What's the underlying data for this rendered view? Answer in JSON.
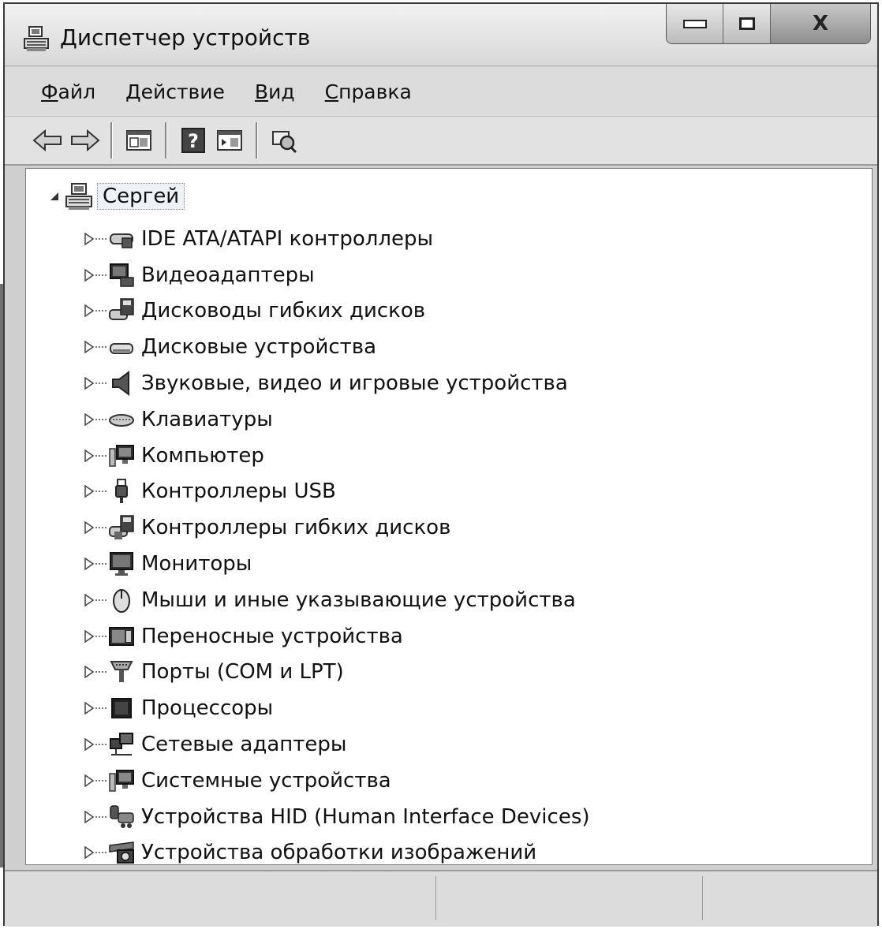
{
  "window": {
    "title": "Диспетчер устройств",
    "icon": "device-manager-icon",
    "caption_buttons": [
      "minimize",
      "maximize",
      "close"
    ],
    "close_glyph": "X"
  },
  "menu": {
    "items": [
      {
        "mnemonic": "Ф",
        "rest": "айл"
      },
      {
        "mnemonic": "Д",
        "rest": "ействие"
      },
      {
        "mnemonic": "В",
        "rest": "ид"
      },
      {
        "mnemonic": "С",
        "rest": "правка"
      }
    ]
  },
  "toolbar": {
    "buttons": [
      "back-icon",
      "forward-icon",
      "properties-pane-icon",
      "help-icon",
      "show-hide-pane-icon",
      "scan-hardware-icon"
    ]
  },
  "tree": {
    "root": "Сергей",
    "items": [
      {
        "label": "IDE ATA/ATAPI контроллеры",
        "icon": "ide-controller-icon"
      },
      {
        "label": "Видеоадаптеры",
        "icon": "display-adapter-icon"
      },
      {
        "label": "Дисководы гибких дисков",
        "icon": "floppy-drive-icon"
      },
      {
        "label": "Дисковые устройства",
        "icon": "disk-drive-icon"
      },
      {
        "label": "Звуковые, видео и игровые устройства",
        "icon": "speaker-icon"
      },
      {
        "label": "Клавиатуры",
        "icon": "keyboard-icon"
      },
      {
        "label": "Компьютер",
        "icon": "computer-icon"
      },
      {
        "label": "Контроллеры USB",
        "icon": "usb-icon"
      },
      {
        "label": "Контроллеры гибких дисков",
        "icon": "floppy-controller-icon"
      },
      {
        "label": "Мониторы",
        "icon": "monitor-icon"
      },
      {
        "label": "Мыши и иные указывающие устройства",
        "icon": "mouse-icon"
      },
      {
        "label": "Переносные устройства",
        "icon": "portable-device-icon"
      },
      {
        "label": "Порты (COM и LPT)",
        "icon": "port-icon"
      },
      {
        "label": "Процессоры",
        "icon": "processor-icon"
      },
      {
        "label": "Сетевые адаптеры",
        "icon": "network-adapter-icon"
      },
      {
        "label": "Системные устройства",
        "icon": "system-device-icon"
      },
      {
        "label": "Устройства HID (Human Interface Devices)",
        "icon": "hid-icon"
      },
      {
        "label": "Устройства обработки изображений",
        "icon": "imaging-device-icon"
      }
    ]
  },
  "statusbar": {
    "cells": [
      "",
      "",
      ""
    ]
  }
}
